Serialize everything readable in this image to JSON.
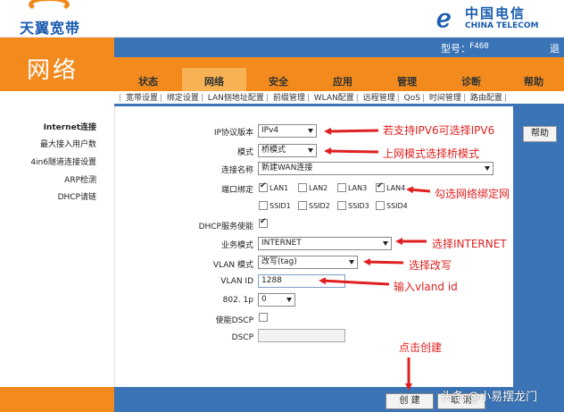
{
  "header": {
    "brand_left": "天翼宽带",
    "brand_right_cn": "中国电信",
    "brand_right_en": "CHINA TELECOM",
    "model_label": "型号：",
    "model_value": "F460",
    "logout_label": "退出"
  },
  "section_title": "网络",
  "tabs": [
    {
      "label": "状态",
      "active": false
    },
    {
      "label": "网络",
      "active": true
    },
    {
      "label": "安全",
      "active": false
    },
    {
      "label": "应用",
      "active": false
    },
    {
      "label": "管理",
      "active": false
    },
    {
      "label": "诊断",
      "active": false
    },
    {
      "label": "帮助",
      "active": false
    }
  ],
  "subnav": [
    "宽带设置",
    "绑定设置",
    "LAN侧地址配置",
    "前缀管理",
    "WLAN配置",
    "远程管理",
    "QoS",
    "时间管理",
    "路由配置"
  ],
  "sidebar": [
    {
      "label": "Internet连接",
      "active": true
    },
    {
      "label": "最大接入用户数",
      "active": false
    },
    {
      "label": "4in6隧道连接设置",
      "active": false
    },
    {
      "label": "ARP检测",
      "active": false
    },
    {
      "label": "DHCP请链",
      "active": false
    }
  ],
  "help_button": "帮助",
  "form": {
    "ip_version": {
      "label": "IP协议版本",
      "value": "IPv4"
    },
    "mode": {
      "label": "模式",
      "value": "桥模式"
    },
    "connection_name": {
      "label": "连接名称",
      "value": "新建WAN连接"
    },
    "port_binding": {
      "label": "端口绑定",
      "ports": [
        {
          "label": "LAN1",
          "checked": true
        },
        {
          "label": "LAN2",
          "checked": false
        },
        {
          "label": "LAN3",
          "checked": false
        },
        {
          "label": "LAN4",
          "checked": true
        },
        {
          "label": "SSID1",
          "checked": false
        },
        {
          "label": "SSID2",
          "checked": false
        },
        {
          "label": "SSID3",
          "checked": false
        },
        {
          "label": "SSID4",
          "checked": false
        }
      ]
    },
    "dhcp_enable": {
      "label": "DHCP服务使能",
      "checked": true
    },
    "service_mode": {
      "label": "业务模式",
      "value": "INTERNET"
    },
    "vlan_mode": {
      "label": "VLAN 模式",
      "value": "改写(tag)"
    },
    "vlan_id": {
      "label": "VLAN ID",
      "value": "1288"
    },
    "dot1p": {
      "label": "802. 1p",
      "value": "0"
    },
    "enable_dscp": {
      "label": "使能DSCP",
      "checked": false
    },
    "dscp": {
      "label": "DSCP",
      "value": ""
    }
  },
  "buttons": {
    "create": "创 建",
    "cancel": "取 消"
  },
  "annotations": {
    "ipv6": "若支持IPV6可选择IPV6",
    "bridge": "上网模式选择桥模式",
    "bind": "勾选网络绑定网",
    "internet": "选择INTERNET",
    "rewrite": "选择改写",
    "vlan": "输入vland id",
    "create": "点击创建"
  },
  "watermark": "头条 @小易摆龙门",
  "colors": {
    "orange": "#f28a1e",
    "blue": "#3b74b6",
    "annotation_red": "#e02020"
  }
}
